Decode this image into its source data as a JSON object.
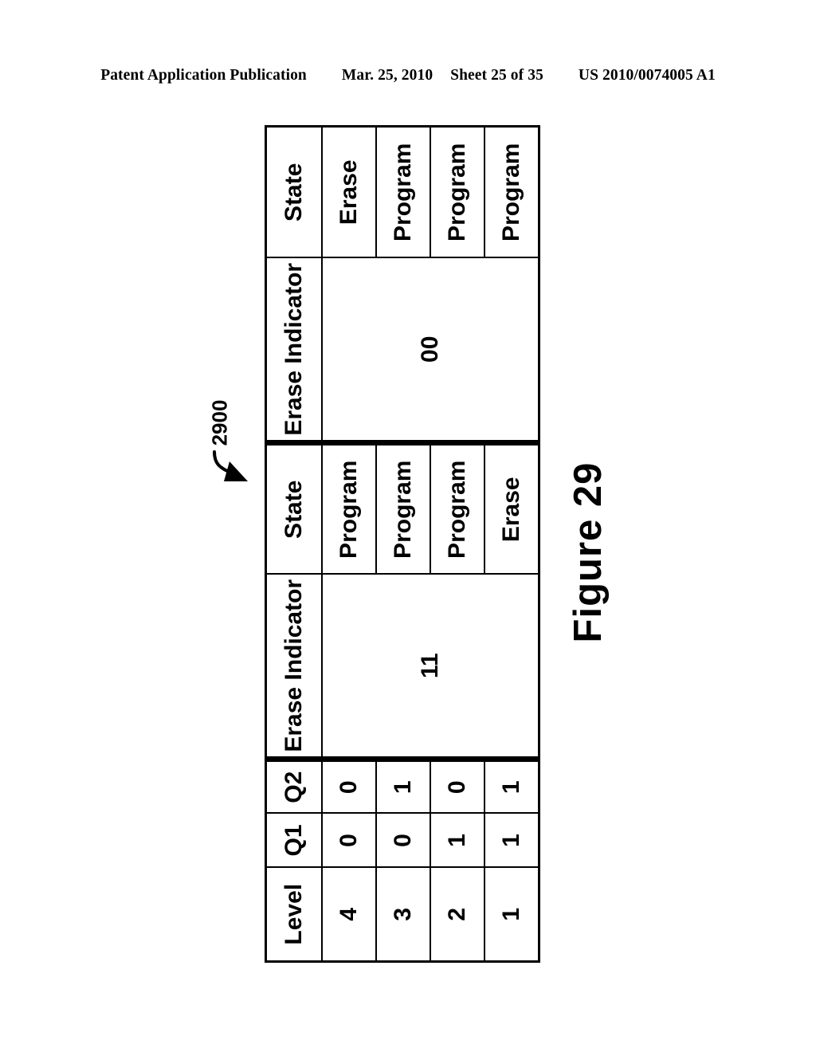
{
  "page_header": {
    "publication": "Patent Application Publication",
    "date": "Mar. 25, 2010",
    "sheet": "Sheet 25 of 35",
    "patent_number": "US 2010/0074005 A1"
  },
  "figure": {
    "caption": "Figure 29",
    "reference_numeral": "2900"
  },
  "table": {
    "columns": [
      {
        "key": "level",
        "header": "Level"
      },
      {
        "key": "q1",
        "header": "Q1"
      },
      {
        "key": "q2",
        "header": "Q2"
      },
      {
        "key": "ei_a",
        "header": "Erase Indicator"
      },
      {
        "key": "state_a",
        "header": "State"
      },
      {
        "key": "ei_b",
        "header": "Erase Indicator"
      },
      {
        "key": "state_b",
        "header": "State"
      }
    ],
    "erase_indicator_a_value": "11",
    "erase_indicator_b_value": "00",
    "rows": [
      {
        "level": "4",
        "q1": "0",
        "q2": "0",
        "state_a": "Program",
        "state_b": "Erase"
      },
      {
        "level": "3",
        "q1": "0",
        "q2": "1",
        "state_a": "Program",
        "state_b": "Program"
      },
      {
        "level": "2",
        "q1": "1",
        "q2": "0",
        "state_a": "Program",
        "state_b": "Program"
      },
      {
        "level": "1",
        "q1": "1",
        "q2": "1",
        "state_a": "Erase",
        "state_b": "Program"
      }
    ]
  }
}
